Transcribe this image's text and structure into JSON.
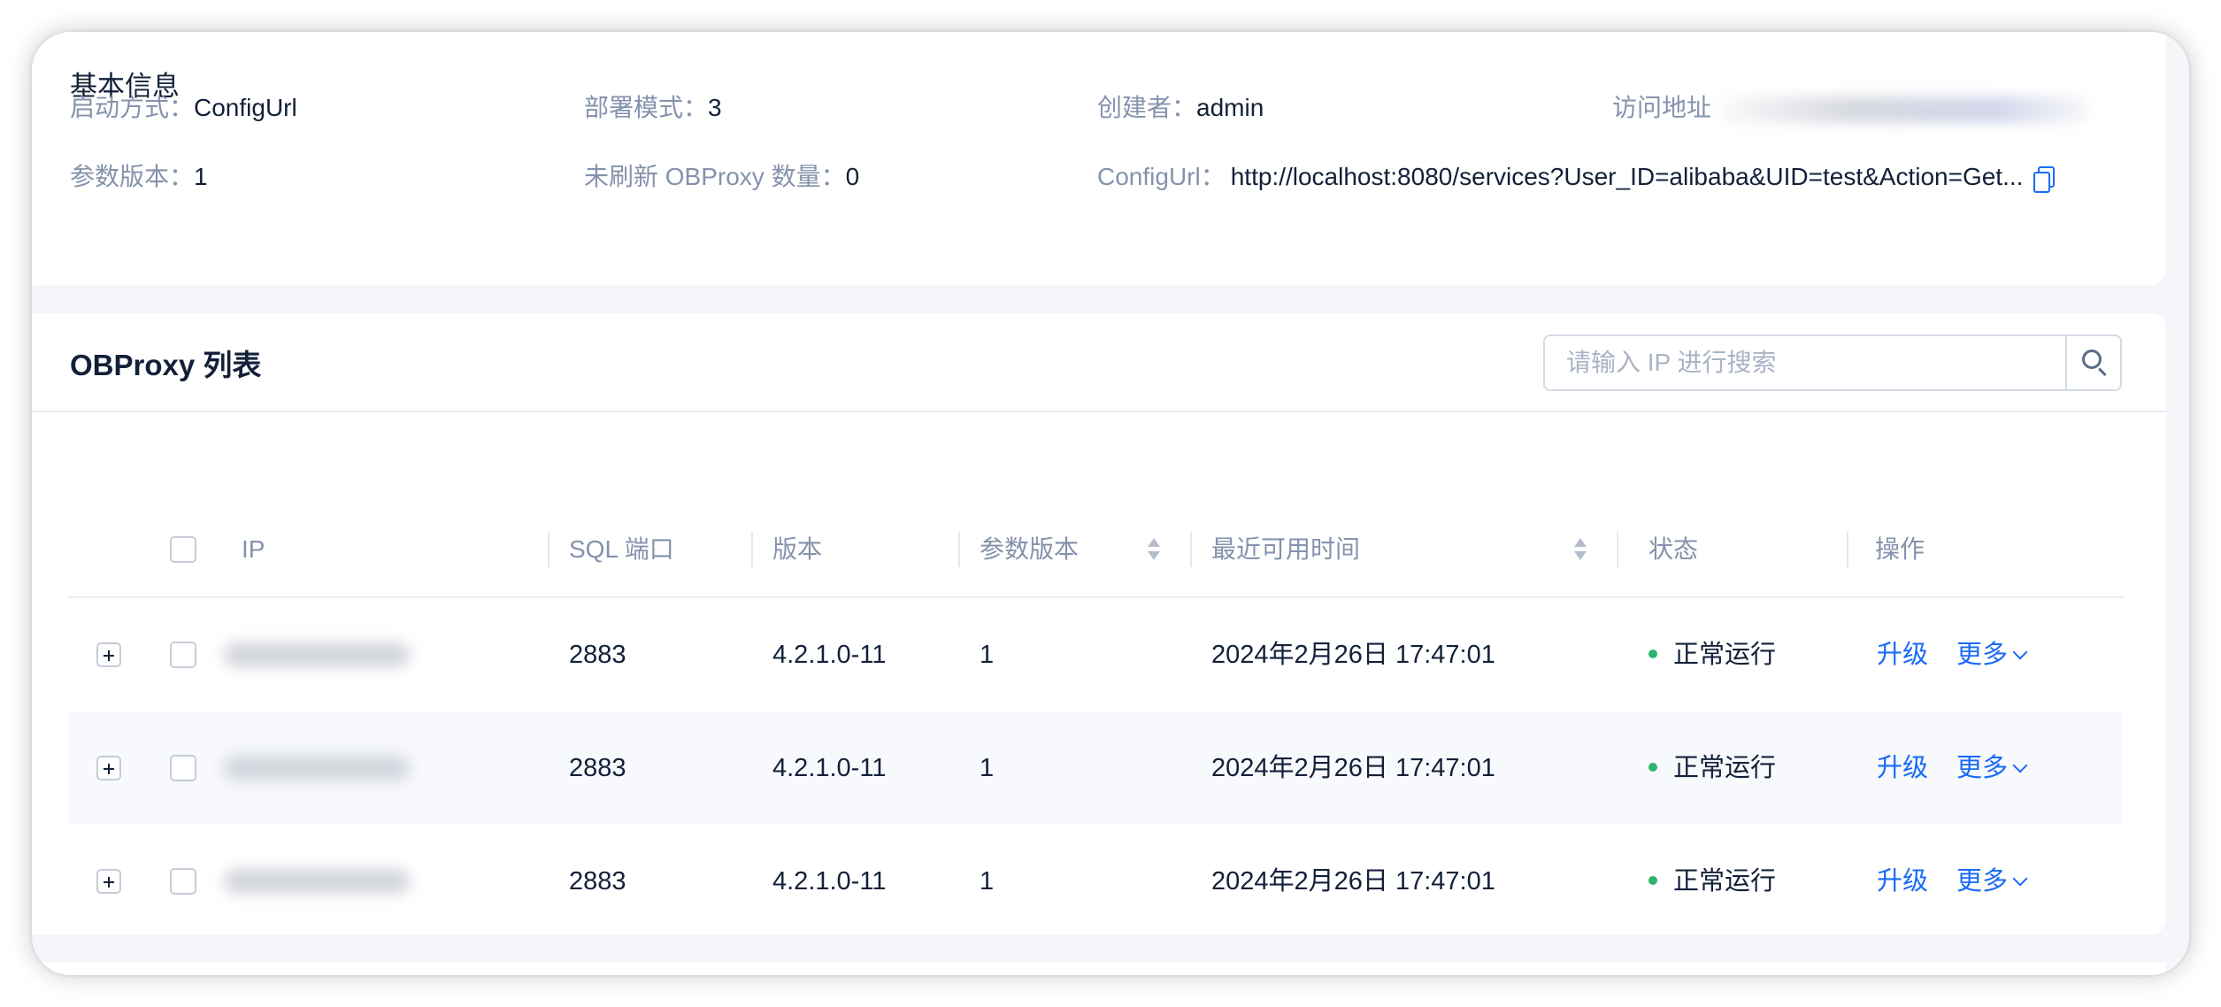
{
  "basic_info": {
    "title": "基本信息",
    "items": [
      {
        "label": "启动方式：",
        "value": "ConfigUrl"
      },
      {
        "label": "部署模式：",
        "value": "3"
      },
      {
        "label": "创建者：",
        "value": "admin"
      },
      {
        "label": "访问地址",
        "value": ""
      },
      {
        "label": "参数版本：",
        "value": "1"
      },
      {
        "label": "未刷新 OBProxy 数量：",
        "value": "0"
      },
      {
        "label": "ConfigUrl：",
        "value": "http://localhost:8080/services?User_ID=alibaba&UID=test&Action=Get..."
      }
    ],
    "copy_icon": "copy-icon"
  },
  "list": {
    "title": "OBProxy 列表",
    "search": {
      "placeholder": "请输入 IP 进行搜索",
      "icon": "search-icon"
    },
    "columns": [
      "IP",
      "SQL 端口",
      "版本",
      "参数版本",
      "最近可用时间",
      "状态",
      "操作"
    ],
    "rows": [
      {
        "ip": "",
        "port": "2883",
        "version": "4.2.1.0-11",
        "param_version": "1",
        "last_available": "2024年2月26日 17:47:01",
        "status": "正常运行",
        "action_upgrade": "升级",
        "action_more": "更多"
      },
      {
        "ip": "",
        "port": "2883",
        "version": "4.2.1.0-11",
        "param_version": "1",
        "last_available": "2024年2月26日 17:47:01",
        "status": "正常运行",
        "action_upgrade": "升级",
        "action_more": "更多"
      },
      {
        "ip": "",
        "port": "2883",
        "version": "4.2.1.0-11",
        "param_version": "1",
        "last_available": "2024年2月26日 17:47:01",
        "status": "正常运行",
        "action_upgrade": "升级",
        "action_more": "更多"
      }
    ]
  },
  "colors": {
    "accent": "#1a6bf5",
    "status_ok": "#2fb36d",
    "label": "#8592ad",
    "text": "#132039",
    "background": "#f4f6fa"
  }
}
